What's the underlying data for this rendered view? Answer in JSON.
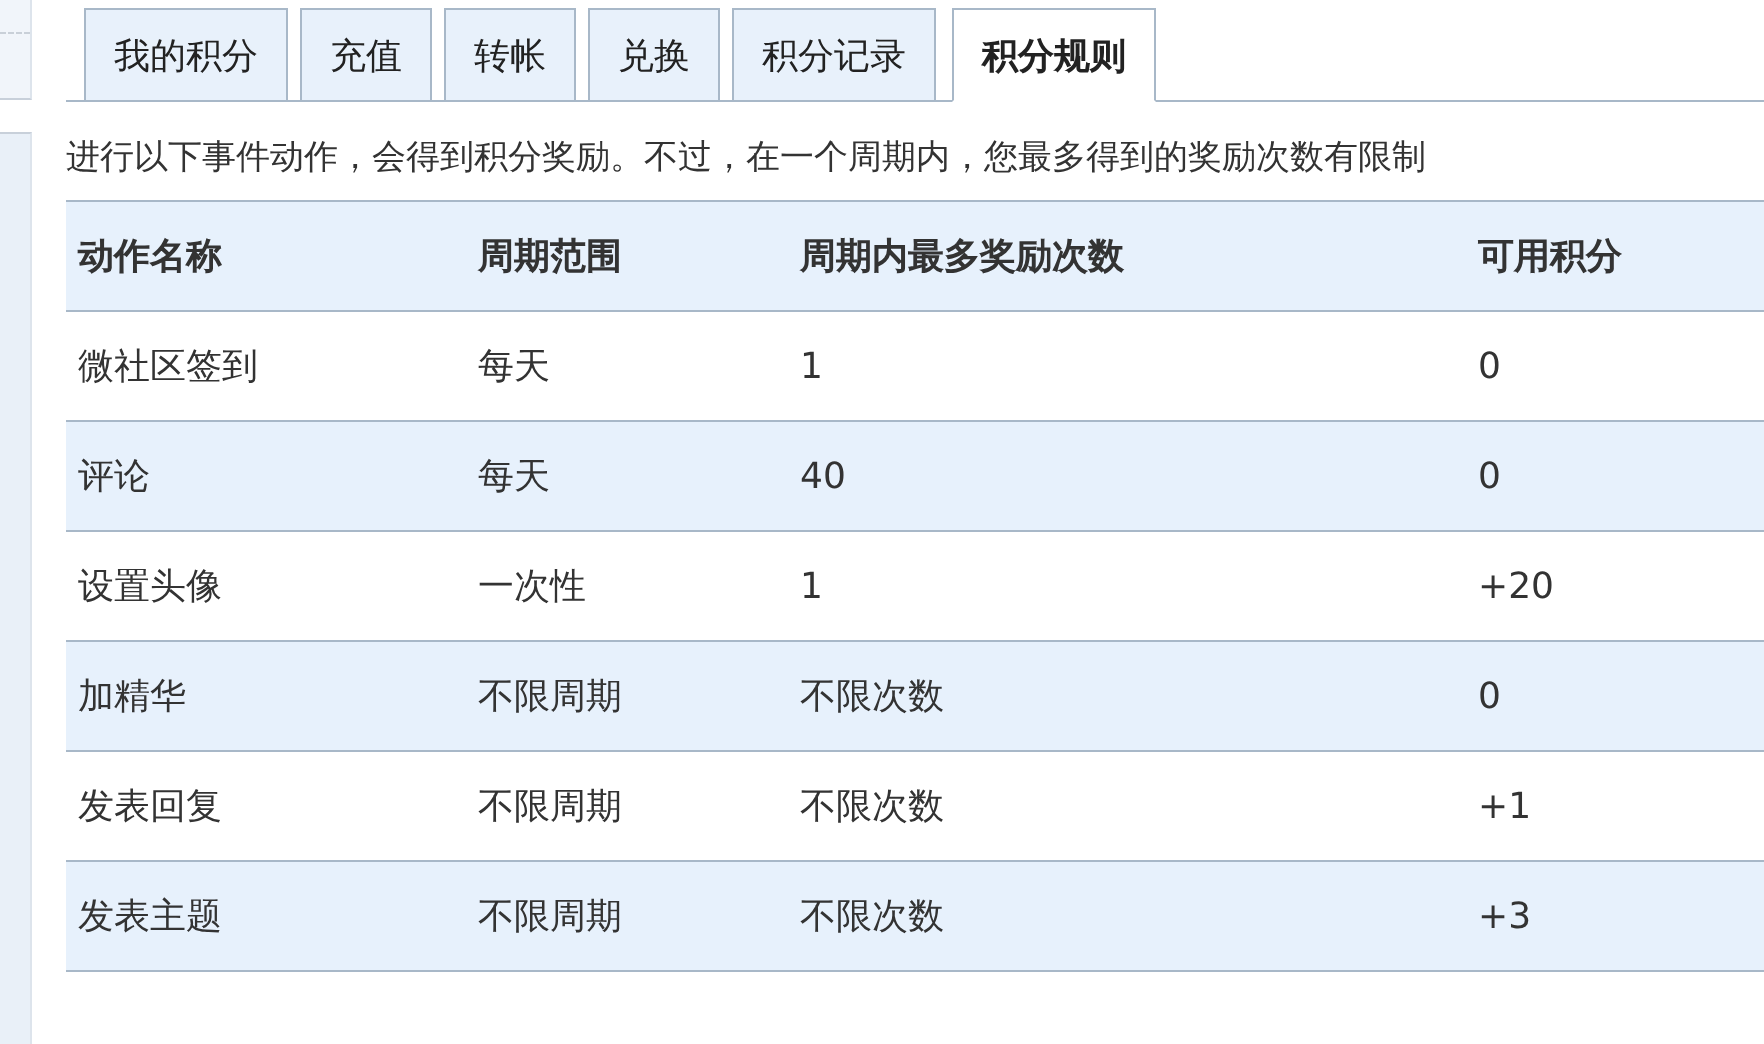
{
  "tabs": [
    {
      "label": "我的积分",
      "selected": false
    },
    {
      "label": "充值",
      "selected": false
    },
    {
      "label": "转帐",
      "selected": false
    },
    {
      "label": "兑换",
      "selected": false
    },
    {
      "label": "积分记录",
      "selected": false
    },
    {
      "label": "积分规则",
      "selected": true
    }
  ],
  "description": "进行以下事件动作，会得到积分奖励。不过，在一个周期内，您最多得到的奖励次数有限制",
  "table": {
    "columns": [
      "动作名称",
      "周期范围",
      "周期内最多奖励次数",
      "可用积分"
    ],
    "rows": [
      [
        "微社区签到",
        "每天",
        "1",
        "0"
      ],
      [
        "评论",
        "每天",
        "40",
        "0"
      ],
      [
        "设置头像",
        "一次性",
        "1",
        "+20"
      ],
      [
        "加精华",
        "不限周期",
        "不限次数",
        "0"
      ],
      [
        "发表回复",
        "不限周期",
        "不限次数",
        "+1"
      ],
      [
        "发表主题",
        "不限周期",
        "不限次数",
        "+3"
      ]
    ]
  }
}
